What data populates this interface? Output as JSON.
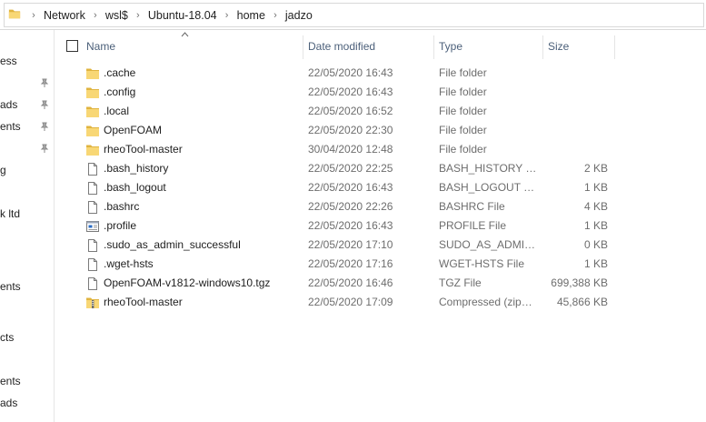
{
  "breadcrumb": [
    "Network",
    "wsl$",
    "Ubuntu-18.04",
    "home",
    "jadzo"
  ],
  "nav_pane": {
    "items": [
      "ess",
      "ads",
      "ents",
      "g",
      "k ltd",
      "ents",
      "cts",
      "ents",
      "ads"
    ]
  },
  "columns": {
    "name": "Name",
    "date": "Date modified",
    "type": "Type",
    "size": "Size"
  },
  "files": [
    {
      "name": ".cache",
      "date": "22/05/2020 16:43",
      "type": "File folder",
      "size": "",
      "icon": "folder-icon"
    },
    {
      "name": ".config",
      "date": "22/05/2020 16:43",
      "type": "File folder",
      "size": "",
      "icon": "folder-icon"
    },
    {
      "name": ".local",
      "date": "22/05/2020 16:52",
      "type": "File folder",
      "size": "",
      "icon": "folder-icon"
    },
    {
      "name": "OpenFOAM",
      "date": "22/05/2020 22:30",
      "type": "File folder",
      "size": "",
      "icon": "folder-icon"
    },
    {
      "name": "rheoTool-master",
      "date": "30/04/2020 12:48",
      "type": "File folder",
      "size": "",
      "icon": "folder-icon"
    },
    {
      "name": ".bash_history",
      "date": "22/05/2020 22:25",
      "type": "BASH_HISTORY File",
      "size": "2 KB",
      "icon": "file-icon"
    },
    {
      "name": ".bash_logout",
      "date": "22/05/2020 16:43",
      "type": "BASH_LOGOUT File",
      "size": "1 KB",
      "icon": "file-icon"
    },
    {
      "name": ".bashrc",
      "date": "22/05/2020 22:26",
      "type": "BASHRC File",
      "size": "4 KB",
      "icon": "file-icon"
    },
    {
      "name": ".profile",
      "date": "22/05/2020 16:43",
      "type": "PROFILE File",
      "size": "1 KB",
      "icon": "settings-file-icon"
    },
    {
      "name": ".sudo_as_admin_successful",
      "date": "22/05/2020 17:10",
      "type": "SUDO_AS_ADMIN_SUCCESSFUL File",
      "size": "0 KB",
      "icon": "file-icon"
    },
    {
      "name": ".wget-hsts",
      "date": "22/05/2020 17:16",
      "type": "WGET-HSTS File",
      "size": "1 KB",
      "icon": "file-icon"
    },
    {
      "name": "OpenFOAM-v1812-windows10.tgz",
      "date": "22/05/2020 16:46",
      "type": "TGZ File",
      "size": "699,388 KB",
      "icon": "file-icon"
    },
    {
      "name": "rheoTool-master",
      "date": "22/05/2020 17:09",
      "type": "Compressed (zipped) Folder",
      "size": "45,866 KB",
      "icon": "zip-folder-icon"
    }
  ],
  "colors": {
    "folder_yellow": "#f8d775",
    "folder_dark": "#e0b440",
    "header_text": "#4c607a",
    "secondary_text": "#6d6d6d"
  }
}
